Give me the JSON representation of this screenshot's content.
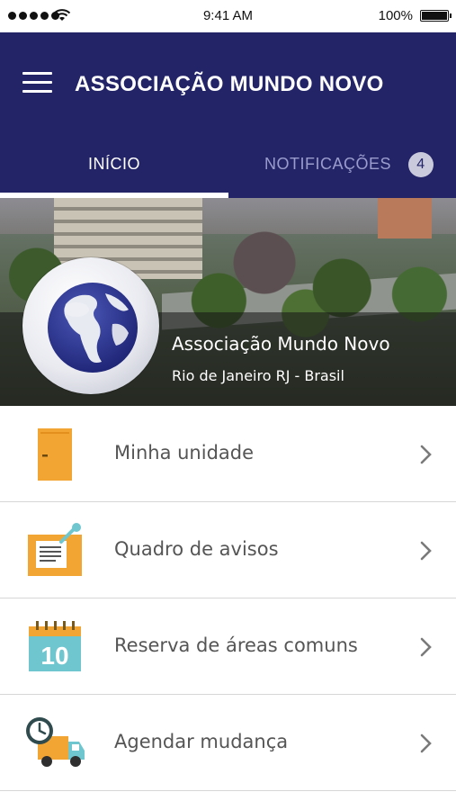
{
  "status_bar": {
    "time": "9:41 AM",
    "battery": "100%"
  },
  "header": {
    "title": "ASSOCIAÇÃO MUNDO NOVO"
  },
  "tabs": [
    {
      "label": "INÍCIO",
      "active": true
    },
    {
      "label": "NOTIFICAÇÕES",
      "badge": "4",
      "active": false
    }
  ],
  "hero": {
    "name": "Associação Mundo Novo",
    "location": "Rio de Janeiro RJ - Brasil"
  },
  "menu": [
    {
      "label": "Minha unidade",
      "icon": "door-icon"
    },
    {
      "label": "Quadro de avisos",
      "icon": "notice-board-icon"
    },
    {
      "label": "Reserva de áreas comuns",
      "icon": "calendar-icon",
      "icon_text": "10"
    },
    {
      "label": "Agendar mudança",
      "icon": "moving-truck-icon"
    }
  ],
  "colors": {
    "header": "#232468",
    "accent": "#f3a533",
    "calendar": "#6fc6cf"
  }
}
